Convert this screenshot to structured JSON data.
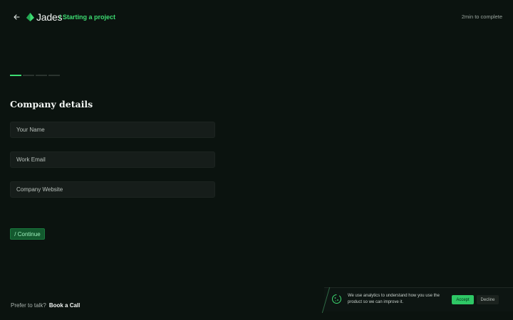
{
  "header": {
    "back_icon": "arrow-left-icon",
    "logo_icon": "jades-leaf-icon",
    "logo_text": "Jades",
    "breadcrumb": "/ Starting a project",
    "time_note": "2min to complete"
  },
  "progress": {
    "steps": 4,
    "current_step": 1
  },
  "form": {
    "title": "Company details",
    "name_placeholder": "Your Name",
    "email_placeholder": "Work Email",
    "website_placeholder": "Company Website",
    "continue_label": "/ Continue"
  },
  "footer": {
    "prefer_text": "Prefer to talk?",
    "book_link": "Book a Call"
  },
  "cookie_banner": {
    "icon": "cookie-icon",
    "text": "We use analytics to understand how you use the product so we can improve it.",
    "accept_label": "Accept",
    "decline_label": "Decline"
  },
  "colors": {
    "background": "#0b130f",
    "accent": "#3ddc72",
    "field_bg": "#161d1a",
    "button_bg": "#13592e"
  }
}
